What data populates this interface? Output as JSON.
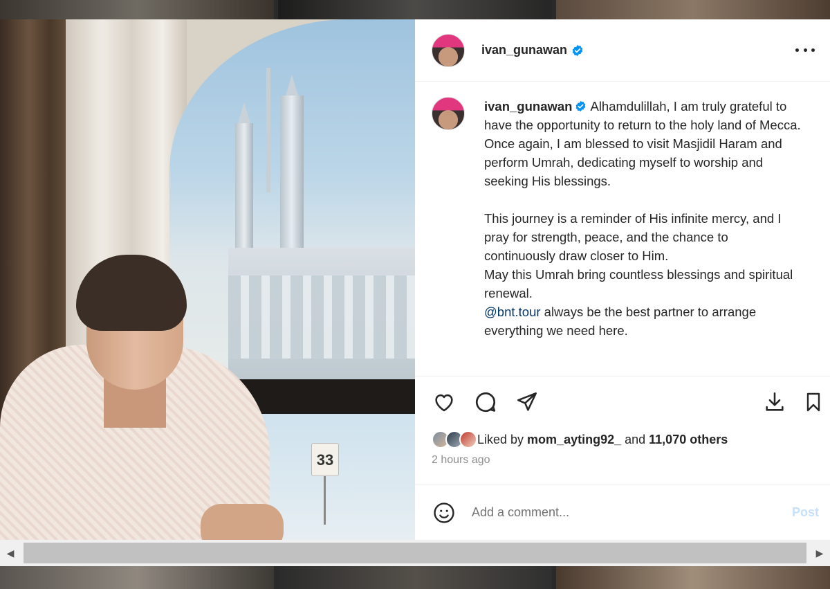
{
  "post": {
    "username": "ivan_gunawan",
    "caption_paragraphs": [
      "Alhamdulillah, I am truly grateful to have the opportunity to return to the holy land of Mecca. Once again, I am blessed to visit Masjidil Haram and perform Umrah, dedicating myself to worship and seeking His blessings.",
      "This journey is a reminder of His infinite mercy, and I pray for strength, peace, and the chance to continuously draw closer to Him.",
      "May this Umrah bring countless blessings and spiritual renewal."
    ],
    "mention": "@bnt.tour",
    "mention_text": " always be the best partner to arrange everything we need here.",
    "photo_sign_number": "33",
    "likes_prefix": "Liked by ",
    "liked_by_user": "mom_ayting92_",
    "likes_and": " and ",
    "likes_others": "11,070 others",
    "time_ago": "2 hours ago"
  },
  "comment": {
    "placeholder": "Add a comment...",
    "post_label": "Post"
  },
  "icons": {
    "more": "more-options-icon",
    "like": "heart-icon",
    "comment": "comment-bubble-icon",
    "share": "share-paper-plane-icon",
    "download": "download-icon",
    "save": "bookmark-icon",
    "emoji": "emoji-smile-icon",
    "verified": "verified-badge-icon",
    "scroll_left": "chevron-left-icon",
    "scroll_right": "chevron-right-icon"
  },
  "colors": {
    "verified": "#0095f6",
    "mention": "#00376b",
    "muted": "#8e8e8e",
    "post_disabled": "#c7e0fb"
  }
}
